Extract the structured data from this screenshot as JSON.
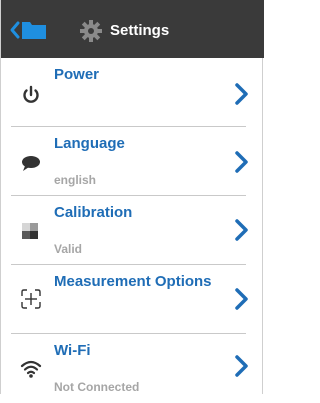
{
  "header": {
    "title": "Settings",
    "back_icon": "back-folder-icon",
    "settings_icon": "gear-icon"
  },
  "colors": {
    "header_bg": "#3a3a3a",
    "accent": "#1f6db6",
    "subtitle": "#a6a6a6"
  },
  "settings": {
    "items": [
      {
        "title": "Power",
        "subtitle": "",
        "icon": "power-icon"
      },
      {
        "title": "Language",
        "subtitle": "english",
        "icon": "speech-bubble-icon"
      },
      {
        "title": "Calibration",
        "subtitle": "Valid",
        "icon": "calibration-squares-icon"
      },
      {
        "title": "Measurement Options",
        "subtitle": "",
        "icon": "crosshair-brackets-icon"
      },
      {
        "title": "Wi-Fi",
        "subtitle": "Not Connected",
        "icon": "wifi-icon"
      }
    ]
  }
}
